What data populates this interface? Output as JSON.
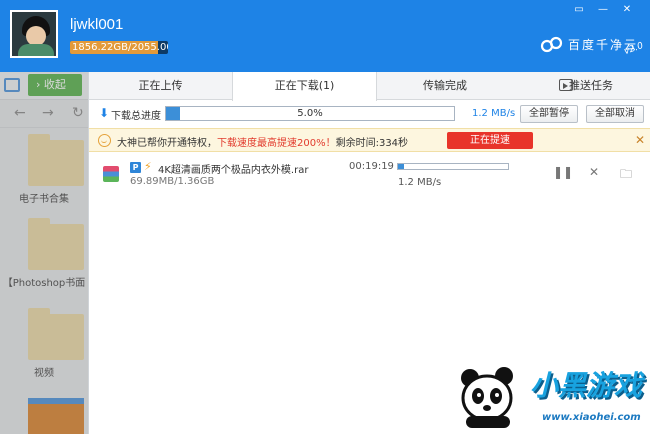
{
  "header": {
    "username": "ljwkl001",
    "quota_text": "1856.22GB/2055.00GB",
    "quota_fraction": 0.903,
    "brand_text": "百度千净云",
    "brand_version": "v2.0"
  },
  "left_pane": {
    "collect_label": "收起",
    "folders": [
      {
        "label": "电子书合集"
      },
      {
        "label": "【Photoshop书面"
      },
      {
        "label": "视频"
      }
    ]
  },
  "tabs": [
    {
      "label": "正在上传"
    },
    {
      "label": "正在下载(1)"
    },
    {
      "label": "传输完成"
    },
    {
      "label": "推送任务"
    }
  ],
  "progress": {
    "label": "下载总进度",
    "percent_text": "5.0%",
    "percent": 5.0,
    "speed": "1.2 MB/s",
    "pause_all": "全部暂停",
    "cancel_all": "全部取消"
  },
  "notice": {
    "text_before": "大神已帮你开通特权，",
    "text_highlight": "下载速度最高提速200%！",
    "text_after": "剩余时间:334秒",
    "button": "正在提速"
  },
  "download_item": {
    "badge": "P",
    "filename": "4K超清画质两个极品内衣外模.rar",
    "size": "69.89MB/1.36GB",
    "eta": "00:19:19",
    "speed": "1.2 MB/s",
    "progress_fraction": 0.05
  },
  "watermark": {
    "brand": "小黑游戏",
    "url": "www.xiaohei.com"
  }
}
